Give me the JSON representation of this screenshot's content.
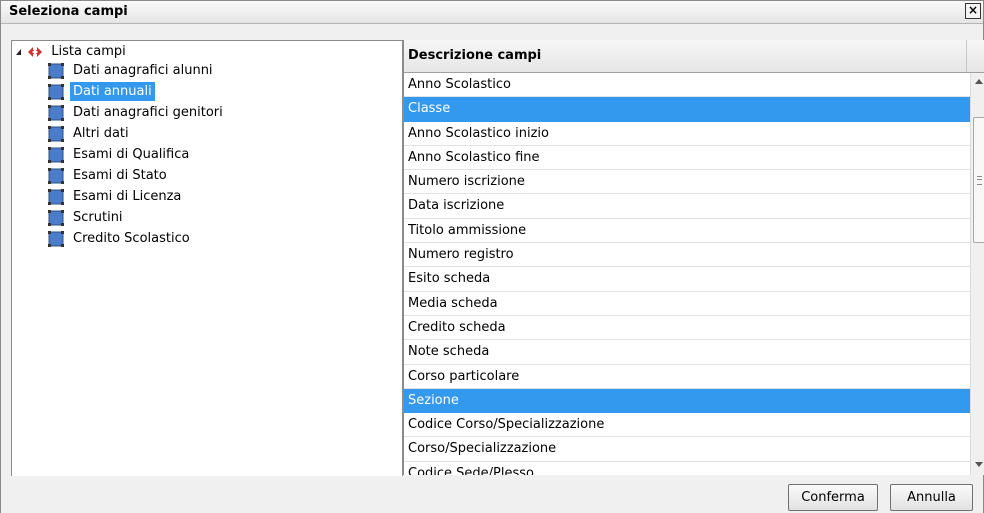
{
  "dialog": {
    "title": "Seleziona campi",
    "close_label": "×"
  },
  "tree": {
    "root_label": "Lista campi",
    "items": [
      {
        "label": "Dati anagrafici alunni",
        "selected": false
      },
      {
        "label": "Dati annuali",
        "selected": true
      },
      {
        "label": "Dati anagrafici genitori",
        "selected": false
      },
      {
        "label": "Altri dati",
        "selected": false
      },
      {
        "label": "Esami di Qualifica",
        "selected": false
      },
      {
        "label": "Esami di Stato",
        "selected": false
      },
      {
        "label": "Esami di Licenza",
        "selected": false
      },
      {
        "label": "Scrutini",
        "selected": false
      },
      {
        "label": "Credito Scolastico",
        "selected": false
      }
    ]
  },
  "grid": {
    "header": "Descrizione campi",
    "rows": [
      {
        "label": "Anno Scolastico",
        "selected": false
      },
      {
        "label": "Classe",
        "selected": true
      },
      {
        "label": "Anno Scolastico inizio",
        "selected": false
      },
      {
        "label": "Anno Scolastico fine",
        "selected": false
      },
      {
        "label": "Numero iscrizione",
        "selected": false
      },
      {
        "label": "Data iscrizione",
        "selected": false
      },
      {
        "label": "Titolo ammissione",
        "selected": false
      },
      {
        "label": "Numero registro",
        "selected": false
      },
      {
        "label": "Esito scheda",
        "selected": false
      },
      {
        "label": "Media scheda",
        "selected": false
      },
      {
        "label": "Credito scheda",
        "selected": false
      },
      {
        "label": "Note scheda",
        "selected": false
      },
      {
        "label": "Corso particolare",
        "selected": false
      },
      {
        "label": "Sezione",
        "selected": true
      },
      {
        "label": "Codice Corso/Specializzazione",
        "selected": false
      },
      {
        "label": "Corso/Specializzazione",
        "selected": false
      },
      {
        "label": "Codice Sede/Plesso",
        "selected": false
      }
    ]
  },
  "buttons": {
    "confirm": "Conferma",
    "cancel": "Annulla"
  },
  "colors": {
    "selection": "#3399ee",
    "node_icon": "#4a7cc9"
  }
}
